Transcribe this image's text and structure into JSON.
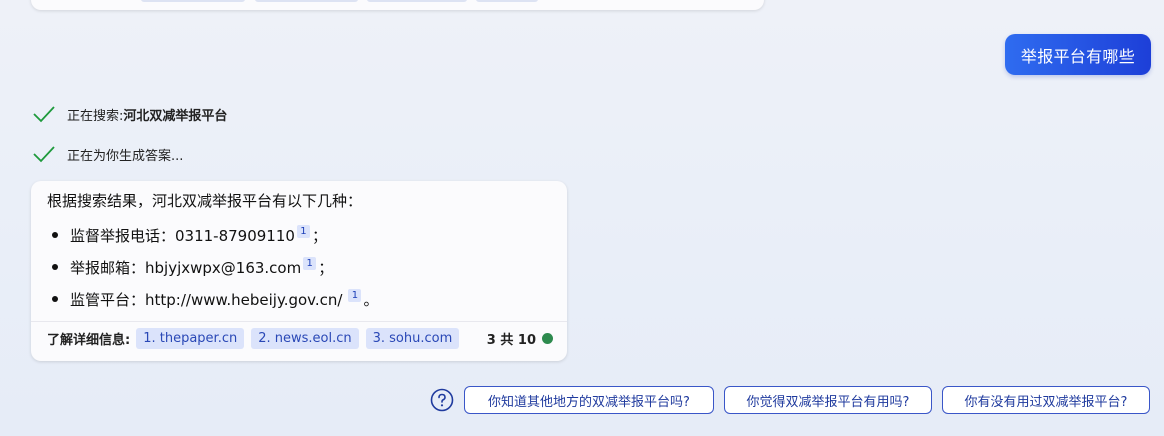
{
  "user_message": "举报平台有哪些",
  "status": [
    {
      "prefix": "正在搜索: ",
      "query": "河北双减举报平台"
    },
    {
      "prefix": "正在为你生成答案...",
      "query": ""
    }
  ],
  "answer": {
    "intro": "根据搜索结果，河北双减举报平台有以下几种：",
    "items": [
      {
        "text": "监督举报电话：0311-87909110",
        "cite": "1",
        "end": "；"
      },
      {
        "text": "举报邮箱：hbjyjxwpx@163.com",
        "cite": "1",
        "end": "；"
      },
      {
        "text": "监管平台：http://www.hebeijy.gov.cn/",
        "cite": "1",
        "end": "。"
      }
    ],
    "learn_more_label": "了解详细信息:",
    "sources": [
      "1. thepaper.cn",
      "2. news.eol.cn",
      "3. sohu.com"
    ],
    "count_text": "3 共 10",
    "count_color": "#2d8a4e"
  },
  "suggestions": [
    "你知道其他地方的双减举报平台吗?",
    "你觉得双减举报平台有用吗?",
    "你有没有用过双减举报平台?"
  ],
  "icons": {
    "check": "check-icon",
    "help": "question-circle-icon"
  },
  "colors": {
    "accent": "#1d3fd8",
    "check": "#1e9a3c",
    "chip_bg": "#dbe3fb"
  }
}
